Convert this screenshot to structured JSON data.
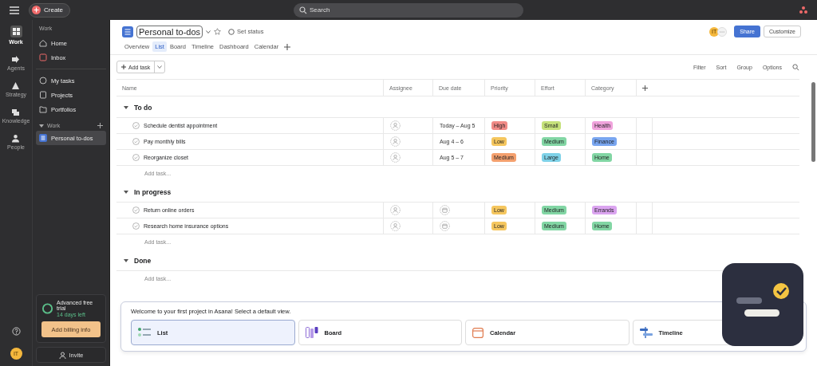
{
  "topbar": {
    "create": "Create",
    "search": {
      "placeholder": "Search"
    }
  },
  "rail": [
    {
      "label": "Work",
      "selected": true
    },
    {
      "label": "Agents",
      "selected": false
    },
    {
      "label": "Strategy",
      "selected": false
    },
    {
      "label": "Knowledge",
      "selected": false
    },
    {
      "label": "People",
      "selected": false
    }
  ],
  "sidebar": {
    "heading": "Work",
    "items": [
      {
        "kind": "home",
        "label": "Home"
      },
      {
        "kind": "inbox",
        "label": "Inbox"
      }
    ],
    "items2": [
      {
        "kind": "tasks",
        "label": "My tasks"
      },
      {
        "kind": "projects",
        "label": "Projects"
      },
      {
        "kind": "portfolios",
        "label": "Portfolios"
      }
    ],
    "team": "Work",
    "projects": [
      {
        "label": "Personal to-dos",
        "selected": true
      }
    ],
    "trial": {
      "title": "Advanced free trial",
      "days": "14 days left",
      "button": "Add billing info"
    },
    "invite": "Invite",
    "avatar": "IT"
  },
  "project": {
    "title": "Personal to-dos",
    "status": "Set status",
    "avatar": "IT",
    "share": "Share",
    "customize": "Customize",
    "tabs": [
      {
        "label": "Overview",
        "selected": false
      },
      {
        "label": "List",
        "selected": true
      },
      {
        "label": "Board",
        "selected": false
      },
      {
        "label": "Timeline",
        "selected": false
      },
      {
        "label": "Dashboard",
        "selected": false
      },
      {
        "label": "Calendar",
        "selected": false
      }
    ]
  },
  "toolbar": {
    "add_task": "Add task",
    "actions": [
      "Filter",
      "Sort",
      "Group",
      "Options"
    ]
  },
  "table": {
    "columns": [
      "Name",
      "Assignee",
      "Due date",
      "Priority",
      "Effort",
      "Category"
    ],
    "sections": [
      {
        "name": "To do",
        "add": "Add task...",
        "rows": [
          {
            "name": "Schedule dentist appointment",
            "due": "Today – Aug 5",
            "priority": {
              "label": "High",
              "color": "#f08a86"
            },
            "effort": {
              "label": "Small",
              "color": "#c5e17a"
            },
            "category": {
              "label": "Health",
              "color": "#f0a3dc"
            }
          },
          {
            "name": "Pay monthly bills",
            "due": "Aug 4 – 6",
            "priority": {
              "label": "Low",
              "color": "#f5c65e"
            },
            "effort": {
              "label": "Medium",
              "color": "#82d6a4"
            },
            "category": {
              "label": "Finance",
              "color": "#79a6f0"
            }
          },
          {
            "name": "Reorganize closet",
            "due": "Aug 5 – 7",
            "priority": {
              "label": "Medium",
              "color": "#f4a06e"
            },
            "effort": {
              "label": "Large",
              "color": "#7fd2e8"
            },
            "category": {
              "label": "Home",
              "color": "#82d6a4"
            }
          }
        ]
      },
      {
        "name": "In progress",
        "add": "Add task...",
        "rows": [
          {
            "name": "Return online orders",
            "priority": {
              "label": "Low",
              "color": "#f5c65e"
            },
            "effort": {
              "label": "Medium",
              "color": "#82d6a4"
            },
            "category": {
              "label": "Errands",
              "color": "#dba4f0"
            }
          },
          {
            "name": "Research home insurance options",
            "priority": {
              "label": "Low",
              "color": "#f5c65e"
            },
            "effort": {
              "label": "Medium",
              "color": "#82d6a4"
            },
            "category": {
              "label": "Home",
              "color": "#82d6a4"
            }
          }
        ]
      },
      {
        "name": "Done",
        "add": "Add task..."
      }
    ]
  },
  "welcome": {
    "text": "Welcome to your first project in Asana! Select a default view.",
    "views": [
      {
        "kind": "list",
        "label": "List",
        "selected": true
      },
      {
        "kind": "board",
        "label": "Board",
        "selected": false
      },
      {
        "kind": "calendar",
        "label": "Calendar",
        "selected": false
      },
      {
        "kind": "timeline",
        "label": "Timeline",
        "selected": false
      }
    ]
  }
}
